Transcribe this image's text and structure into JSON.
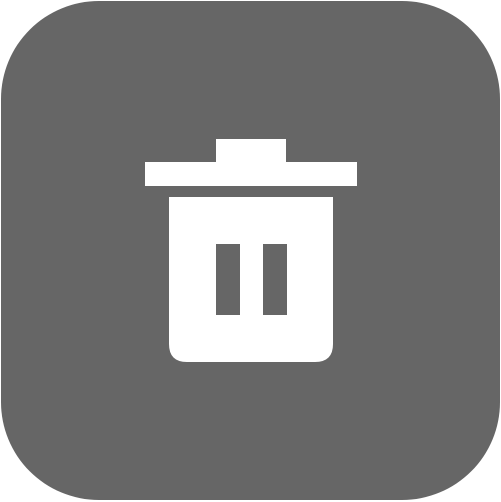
{
  "colors": {
    "tile_background": "#666666",
    "glyph": "#ffffff",
    "page_background": "#ffffff"
  },
  "icon": {
    "name": "trash-icon",
    "tile": "app-icon-tile"
  }
}
